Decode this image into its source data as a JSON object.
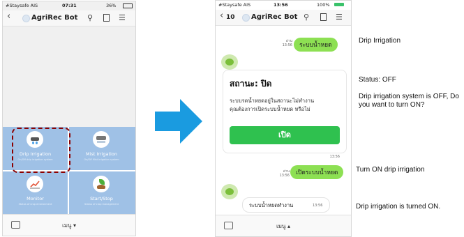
{
  "left_phone": {
    "status": {
      "carrier": "#Staysafe AIS",
      "time": "07:31",
      "battery": "36%"
    },
    "title": "AgriRec Bot",
    "tiles": [
      {
        "label": "Drip Irrigation",
        "sub": "On/Off drip irrigation system",
        "icon": "drip-icon"
      },
      {
        "label": "Mist Irrigation",
        "sub": "On/Off Mist irrigation system",
        "icon": "mist-icon"
      },
      {
        "label": "Monitor",
        "sub": "Status of crop environment",
        "icon": "monitor-chart-icon"
      },
      {
        "label": "Start/Stop",
        "sub": "Status of crop management",
        "icon": "plant-icon"
      }
    ],
    "menu_label": "เมนู ▾"
  },
  "right_phone": {
    "status": {
      "carrier": "#Staysafe AIS",
      "time": "13:56",
      "battery": "100%"
    },
    "back_count": "10",
    "title": "AgriRec Bot",
    "messages": [
      {
        "read": "อ่าน",
        "time": "13:56",
        "text": "ระบบน้ำหยด"
      },
      {
        "card_title": "สถานะ: ปิด",
        "card_body_1": "ระบบรดน้ำหยดอยู่ในสถานะไม่ทำงาน",
        "card_body_2": "คุณต้องการเปิดระบบน้ำหยด หรือไม่",
        "card_button": "เปิด",
        "time": "13:56"
      },
      {
        "read": "อ่าน",
        "time": "13:56",
        "text": "เปิดระบบน้ำหยด"
      },
      {
        "text": "ระบบน้ำหยดทำงาน",
        "time": "13:56"
      }
    ],
    "menu_label": "เมนู ▴"
  },
  "annotations": {
    "a1": "Drip Irrigation",
    "a2": "Status: OFF",
    "a3": "Drip irrigation system is OFF, Do you want to turn ON?",
    "a4": "Turn ON drip irrigation",
    "a5": "Drip irrigation is turned ON."
  },
  "colors": {
    "bubble_green": "#8de053",
    "button_green": "#2fc14f",
    "tile_blue": "#9fc1e6",
    "arrow_blue": "#1a9be0",
    "highlight_red": "#8b0000"
  }
}
